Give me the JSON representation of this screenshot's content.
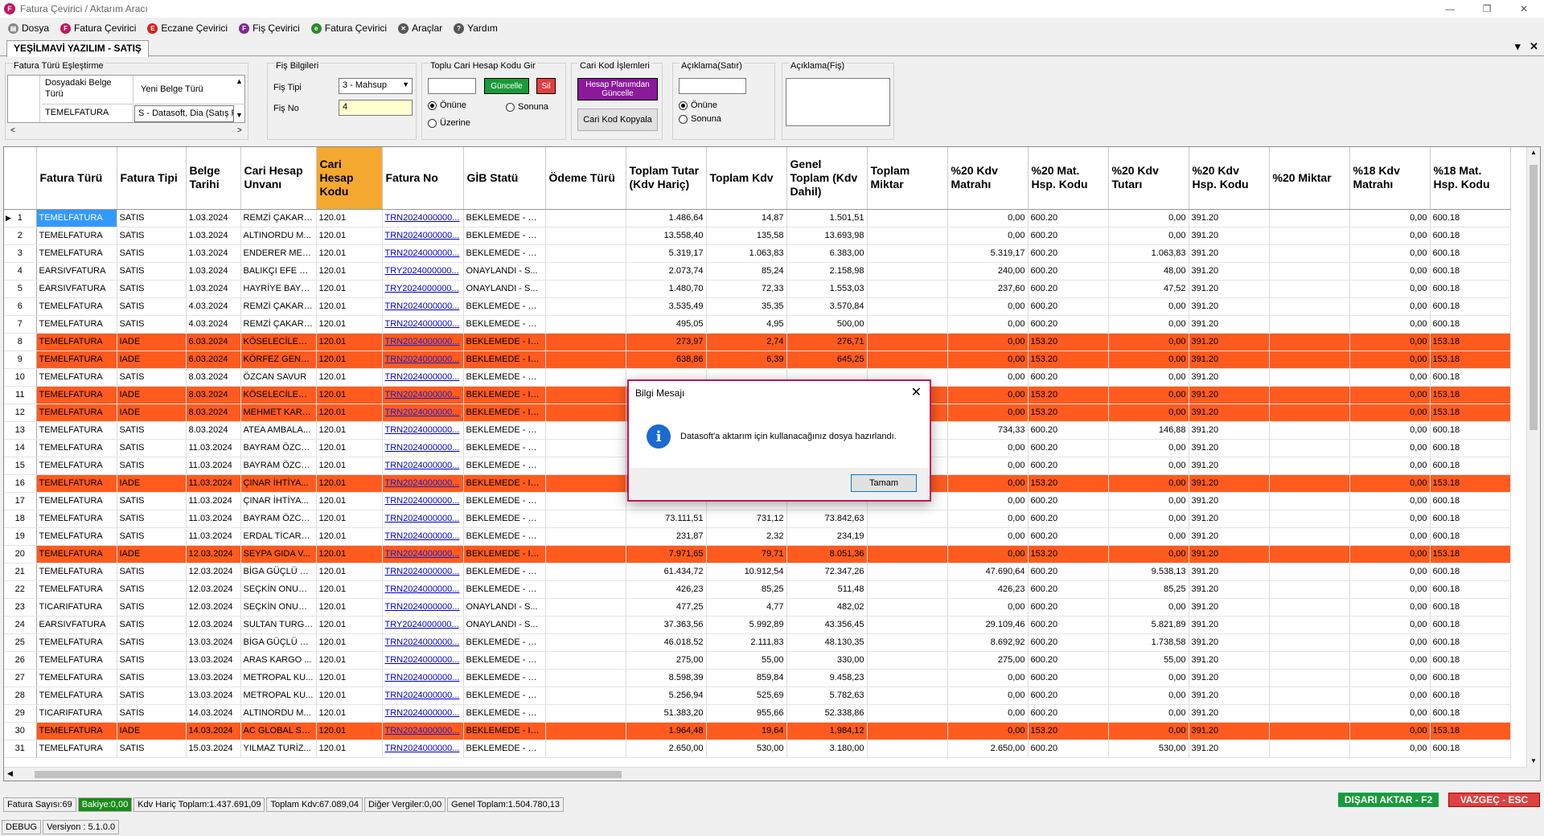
{
  "window": {
    "title": "Fatura Çevirici / Aktarım Aracı",
    "logo": "F"
  },
  "menu": [
    {
      "label": "Dosya",
      "icon": "document-icon",
      "color": "#888888",
      "glyph": "▤"
    },
    {
      "label": "Fatura Çevirici",
      "icon": "invoice-icon",
      "color": "#c4145c",
      "glyph": "F"
    },
    {
      "label": "Eczane Çevirici",
      "icon": "pharmacy-icon",
      "color": "#d62020",
      "glyph": "E"
    },
    {
      "label": "Fiş Çevirici",
      "icon": "receipt-icon",
      "color": "#7a2a9a",
      "glyph": "F"
    },
    {
      "label": "Fatura Çevirici",
      "icon": "einvoice-icon",
      "color": "#2a8a2a",
      "glyph": "e"
    },
    {
      "label": "Araçlar",
      "icon": "tools-icon",
      "color": "#555555",
      "glyph": "✕"
    },
    {
      "label": "Yardım",
      "icon": "help-icon",
      "color": "#555555",
      "glyph": "?"
    }
  ],
  "tab": {
    "label": "YEŞİLMAVİ YAZILIM - SATIŞ"
  },
  "groups": {
    "fatura_turu": {
      "title": "Fatura Türü Eşleştirme",
      "col1": "Dosyadaki Belge Türü",
      "col2": "Yeni Belge Türü",
      "row_key": "TEMELFATURA",
      "row_value": "S - Datasoft, Dia (Satış Fat"
    },
    "fis": {
      "title": "Fiş Bilgileri",
      "tip_label": "Fiş Tipi",
      "tip_value": "3 - Mahsup",
      "no_label": "Fiş No",
      "no_value": "4"
    },
    "toplu": {
      "title": "Toplu Cari Hesap Kodu Gir",
      "input": "",
      "update": "Güncelle",
      "delete": "Sil",
      "opt1": "Önüne",
      "opt2": "Sonuna",
      "opt3": "Üzerine"
    },
    "cari": {
      "title": "Cari Kod İşlemleri",
      "btn1": "Hesap Planımdan Güncelle",
      "btn2": "Cari Kod Kopyala"
    },
    "aciklama_satir": {
      "title": "Açıklama(Satır)",
      "input": "",
      "opt1": "Önüne",
      "opt2": "Sonuna"
    },
    "aciklama_fis": {
      "title": "Açıklama(Fiş)",
      "input": ""
    }
  },
  "grid": {
    "columns": [
      "Fatura Türü",
      "Fatura Tipi",
      "Belge Tarihi",
      "Cari Hesap Unvanı",
      "Cari Hesap Kodu",
      "Fatura No",
      "GİB Statü",
      "Ödeme Türü",
      "Toplam Tutar (Kdv Hariç)",
      "Toplam Kdv",
      "Genel Toplam (Kdv Dahil)",
      "Toplam Miktar",
      "%20 Kdv Matrahı",
      "%20 Mat. Hsp. Kodu",
      "%20 Kdv Tutarı",
      "%20 Kdv Hsp. Kodu",
      "%20 Miktar",
      "%18 Kdv Matrahı",
      "%18 Mat. Hsp. Kodu"
    ],
    "rows": [
      [
        "1",
        "TEMELFATURA",
        "SATIS",
        "1.03.2024",
        "REMZİ ÇAKAR ...",
        "120.01",
        "TRN2024000000...",
        "BEKLEMEDE - SA...",
        "",
        "1.486,64",
        "14,87",
        "1.501,51",
        "",
        "0,00",
        "600.20",
        "0,00",
        "391.20",
        "",
        "0,00",
        "600.18"
      ],
      [
        "2",
        "TEMELFATURA",
        "SATIS",
        "1.03.2024",
        "ALTINORDU M...",
        "120.01",
        "TRN2024000000...",
        "BEKLEMEDE - SA...",
        "",
        "13.558,40",
        "135,58",
        "13.693,98",
        "",
        "0,00",
        "600.20",
        "0,00",
        "391.20",
        "",
        "0,00",
        "600.18"
      ],
      [
        "3",
        "TEMELFATURA",
        "SATIS",
        "1.03.2024",
        "ENDERER MEŞ...",
        "120.01",
        "TRN2024000000...",
        "BEKLEMEDE - SA...",
        "",
        "5.319,17",
        "1.063,83",
        "6.383,00",
        "",
        "5.319,17",
        "600.20",
        "1.063,83",
        "391.20",
        "",
        "0,00",
        "600.18"
      ],
      [
        "4",
        "EARSIVFATURA",
        "SATIS",
        "1.03.2024",
        "BALIKÇI EFE G...",
        "120.01",
        "TRY2024000000...",
        "ONAYLANDI - S...",
        "",
        "2.073,74",
        "85,24",
        "2.158,98",
        "",
        "240,00",
        "600.20",
        "48,00",
        "391.20",
        "",
        "0,00",
        "600.18"
      ],
      [
        "5",
        "EARSIVFATURA",
        "SATIS",
        "1.03.2024",
        "HAYRİYE BAYK...",
        "120.01",
        "TRY2024000000...",
        "ONAYLANDI - S...",
        "",
        "1.480,70",
        "72,33",
        "1.553,03",
        "",
        "237,60",
        "600.20",
        "47,52",
        "391.20",
        "",
        "0,00",
        "600.18"
      ],
      [
        "6",
        "TEMELFATURA",
        "SATIS",
        "4.03.2024",
        "REMZİ ÇAKAR ...",
        "120.01",
        "TRN2024000000...",
        "BEKLEMEDE - SA...",
        "",
        "3.535,49",
        "35,35",
        "3.570,84",
        "",
        "0,00",
        "600.20",
        "0,00",
        "391.20",
        "",
        "0,00",
        "600.18"
      ],
      [
        "7",
        "TEMELFATURA",
        "SATIS",
        "4.03.2024",
        "REMZİ ÇAKAR ...",
        "120.01",
        "TRN2024000000...",
        "BEKLEMEDE - SA...",
        "",
        "495,05",
        "4,95",
        "500,00",
        "",
        "0,00",
        "600.20",
        "0,00",
        "391.20",
        "",
        "0,00",
        "600.18"
      ],
      [
        "8",
        "TEMELFATURA",
        "IADE",
        "6.03.2024",
        "KÖSELECİLER ...",
        "120.01",
        "TRN2024000000...",
        "BEKLEMEDE - IA...",
        "",
        "273,97",
        "2,74",
        "276,71",
        "",
        "0,00",
        "153.20",
        "0,00",
        "391.20",
        "",
        "0,00",
        "153.18"
      ],
      [
        "9",
        "TEMELFATURA",
        "IADE",
        "6.03.2024",
        "KÖRFEZ GENÇ ...",
        "120.01",
        "TRN2024000000...",
        "BEKLEMEDE - IA...",
        "",
        "638,86",
        "6,39",
        "645,25",
        "",
        "0,00",
        "153.20",
        "0,00",
        "391.20",
        "",
        "0,00",
        "153.18"
      ],
      [
        "10",
        "TEMELFATURA",
        "SATIS",
        "8.03.2024",
        "ÖZCAN SAVUR",
        "120.01",
        "TRN2024000000...",
        "BEKLEMEDE - SA...",
        "",
        "",
        "",
        "",
        "",
        "0,00",
        "600.20",
        "0,00",
        "391.20",
        "",
        "0,00",
        "600.18"
      ],
      [
        "11",
        "TEMELFATURA",
        "IADE",
        "8.03.2024",
        "KÖSELECİLER ...",
        "120.01",
        "TRN2024000000...",
        "BEKLEMEDE - IA...",
        "",
        "",
        "",
        "",
        "",
        "0,00",
        "153.20",
        "0,00",
        "391.20",
        "",
        "0,00",
        "153.18"
      ],
      [
        "12",
        "TEMELFATURA",
        "IADE",
        "8.03.2024",
        "MEHMET KARA...",
        "120.01",
        "TRN2024000000...",
        "BEKLEMEDE - IA...",
        "",
        "",
        "",
        "",
        "",
        "0,00",
        "153.20",
        "0,00",
        "391.20",
        "",
        "0,00",
        "153.18"
      ],
      [
        "13",
        "TEMELFATURA",
        "SATIS",
        "8.03.2024",
        "ATEA AMBALA...",
        "120.01",
        "TRN2024000000...",
        "BEKLEMEDE - SA...",
        "",
        "",
        "",
        "",
        "",
        "734,33",
        "600.20",
        "146,88",
        "391.20",
        "",
        "0,00",
        "600.18"
      ],
      [
        "14",
        "TEMELFATURA",
        "SATIS",
        "11.03.2024",
        "BAYRAM ÖZCAN",
        "120.01",
        "TRN2024000000...",
        "BEKLEMEDE - SA...",
        "",
        "",
        "",
        "",
        "",
        "0,00",
        "600.20",
        "0,00",
        "391.20",
        "",
        "0,00",
        "600.18"
      ],
      [
        "15",
        "TEMELFATURA",
        "SATIS",
        "11.03.2024",
        "BAYRAM ÖZCAN",
        "120.01",
        "TRN2024000000...",
        "BEKLEMEDE - SA...",
        "",
        "",
        "",
        "",
        "",
        "0,00",
        "600.20",
        "0,00",
        "391.20",
        "",
        "0,00",
        "600.18"
      ],
      [
        "16",
        "TEMELFATURA",
        "IADE",
        "11.03.2024",
        "ÇINAR İHTİYA...",
        "120.01",
        "TRN2024000000...",
        "BEKLEMEDE - IA...",
        "",
        "",
        "",
        "",
        "",
        "0,00",
        "153.20",
        "0,00",
        "391.20",
        "",
        "0,00",
        "153.18"
      ],
      [
        "17",
        "TEMELFATURA",
        "SATIS",
        "11.03.2024",
        "ÇINAR İHTİYA...",
        "120.01",
        "TRN2024000000...",
        "BEKLEMEDE - SA...",
        "",
        "",
        "",
        "",
        "",
        "0,00",
        "600.20",
        "0,00",
        "391.20",
        "",
        "0,00",
        "600.18"
      ],
      [
        "18",
        "TEMELFATURA",
        "SATIS",
        "11.03.2024",
        "BAYRAM ÖZCAN",
        "120.01",
        "TRN2024000000...",
        "BEKLEMEDE - SA...",
        "",
        "73.111,51",
        "731,12",
        "73.842,63",
        "",
        "0,00",
        "600.20",
        "0,00",
        "391.20",
        "",
        "0,00",
        "600.18"
      ],
      [
        "19",
        "TEMELFATURA",
        "SATIS",
        "11.03.2024",
        "ERDAL TİCARE...",
        "120.01",
        "TRN2024000000...",
        "BEKLEMEDE - SA...",
        "",
        "231,87",
        "2,32",
        "234,19",
        "",
        "0,00",
        "600.20",
        "0,00",
        "391.20",
        "",
        "0,00",
        "600.18"
      ],
      [
        "20",
        "TEMELFATURA",
        "IADE",
        "12.03.2024",
        "SEYPA GIDA V...",
        "120.01",
        "TRN2024000000...",
        "BEKLEMEDE - IA...",
        "",
        "7.971,65",
        "79,71",
        "8.051,36",
        "",
        "0,00",
        "153.20",
        "0,00",
        "391.20",
        "",
        "0,00",
        "153.18"
      ],
      [
        "21",
        "TEMELFATURA",
        "SATIS",
        "12.03.2024",
        "BİGA GÜÇLÜ G...",
        "120.01",
        "TRN2024000000...",
        "BEKLEMEDE - SA...",
        "",
        "61.434,72",
        "10.912,54",
        "72.347,26",
        "",
        "47.690,64",
        "600.20",
        "9.538,13",
        "391.20",
        "",
        "0,00",
        "600.18"
      ],
      [
        "22",
        "TEMELFATURA",
        "SATIS",
        "12.03.2024",
        "SEÇKİN ONUR ...",
        "120.01",
        "TRN2024000000...",
        "BEKLEMEDE - SA...",
        "",
        "426,23",
        "85,25",
        "511,48",
        "",
        "426,23",
        "600.20",
        "85,25",
        "391.20",
        "",
        "0,00",
        "600.18"
      ],
      [
        "23",
        "TICARIFATURA",
        "SATIS",
        "12.03.2024",
        "SEÇKİN ONUR ...",
        "120.01",
        "TRN2024000000...",
        "ONAYLANDI - S...",
        "",
        "477,25",
        "4,77",
        "482,02",
        "",
        "0,00",
        "600.20",
        "0,00",
        "391.20",
        "",
        "0,00",
        "600.18"
      ],
      [
        "24",
        "EARSIVFATURA",
        "SATIS",
        "12.03.2024",
        "SULTAN TURGUT",
        "120.01",
        "TRY2024000000...",
        "ONAYLANDI - S...",
        "",
        "37.363,56",
        "5.992,89",
        "43.356,45",
        "",
        "29.109,46",
        "600.20",
        "5.821,89",
        "391.20",
        "",
        "0,00",
        "600.18"
      ],
      [
        "25",
        "TEMELFATURA",
        "SATIS",
        "13.03.2024",
        "BİGA GÜÇLÜ G...",
        "120.01",
        "TRN2024000000...",
        "BEKLEMEDE - SA...",
        "",
        "46.018,52",
        "2.111,83",
        "48.130,35",
        "",
        "8.692,92",
        "600.20",
        "1.738,58",
        "391.20",
        "",
        "0,00",
        "600.18"
      ],
      [
        "26",
        "TEMELFATURA",
        "SATIS",
        "13.03.2024",
        "ARAS KARGO ...",
        "120.01",
        "TRN2024000000...",
        "BEKLEMEDE - SA...",
        "",
        "275,00",
        "55,00",
        "330,00",
        "",
        "275,00",
        "600.20",
        "55,00",
        "391.20",
        "",
        "0,00",
        "600.18"
      ],
      [
        "27",
        "TEMELFATURA",
        "SATIS",
        "13.03.2024",
        "METROPAL KU...",
        "120.01",
        "TRN2024000000...",
        "BEKLEMEDE - SA...",
        "",
        "8.598,39",
        "859,84",
        "9.458,23",
        "",
        "0,00",
        "600.20",
        "0,00",
        "391.20",
        "",
        "0,00",
        "600.18"
      ],
      [
        "28",
        "TEMELFATURA",
        "SATIS",
        "13.03.2024",
        "METROPAL KU...",
        "120.01",
        "TRN2024000000...",
        "BEKLEMEDE - SA...",
        "",
        "5.256,94",
        "525,69",
        "5.782,63",
        "",
        "0,00",
        "600.20",
        "0,00",
        "391.20",
        "",
        "0,00",
        "600.18"
      ],
      [
        "29",
        "TICARIFATURA",
        "SATIS",
        "14.03.2024",
        "ALTINORDU M...",
        "120.01",
        "TRN2024000000...",
        "BEKLEMEDE - SA...",
        "",
        "51.383,20",
        "955,66",
        "52.338,86",
        "",
        "0,00",
        "600.20",
        "0,00",
        "391.20",
        "",
        "0,00",
        "600.18"
      ],
      [
        "30",
        "TEMELFATURA",
        "IADE",
        "14.03.2024",
        "AC GLOBAL SU...",
        "120.01",
        "TRN2024000000...",
        "BEKLEMEDE - IA...",
        "",
        "1.964,48",
        "19,64",
        "1.984,12",
        "",
        "0,00",
        "153.20",
        "0,00",
        "391.20",
        "",
        "0,00",
        "153.18"
      ],
      [
        "31",
        "TEMELFATURA",
        "SATIS",
        "15.03.2024",
        "YILMAZ TURİZ...",
        "120.01",
        "TRN2024000000...",
        "BEKLEMEDE - SA...",
        "",
        "2.650,00",
        "530,00",
        "3.180,00",
        "",
        "2.650,00",
        "600.20",
        "530,00",
        "391.20",
        "",
        "0,00",
        "600.18"
      ]
    ]
  },
  "status": {
    "count": "Fatura Sayısı:69",
    "balance": "Bakiye:0,00",
    "net": "Kdv Hariç Toplam:1.437.691,09",
    "vat": "Toplam Kdv:67.089,04",
    "other": "Diğer Vergiler:0,00",
    "total": "Genel Toplam:1.504.780,13"
  },
  "actions": {
    "export": "DIŞARI AKTAR - F2",
    "cancel": "VAZGEÇ - ESC"
  },
  "footer": {
    "mode": "DEBUG",
    "version": "Versiyon : 5.1.0.0"
  },
  "dialog": {
    "title": "Bilgi Mesajı",
    "message": "Datasoft'a aktarım için kullanacağınız dosya hazırlandı.",
    "ok": "Tamam"
  },
  "colors": {
    "accent": "#c4145c",
    "iade_row": "#ff5b1f",
    "selected_cell": "#3399ff",
    "highlight_header": "#f5a82f"
  }
}
